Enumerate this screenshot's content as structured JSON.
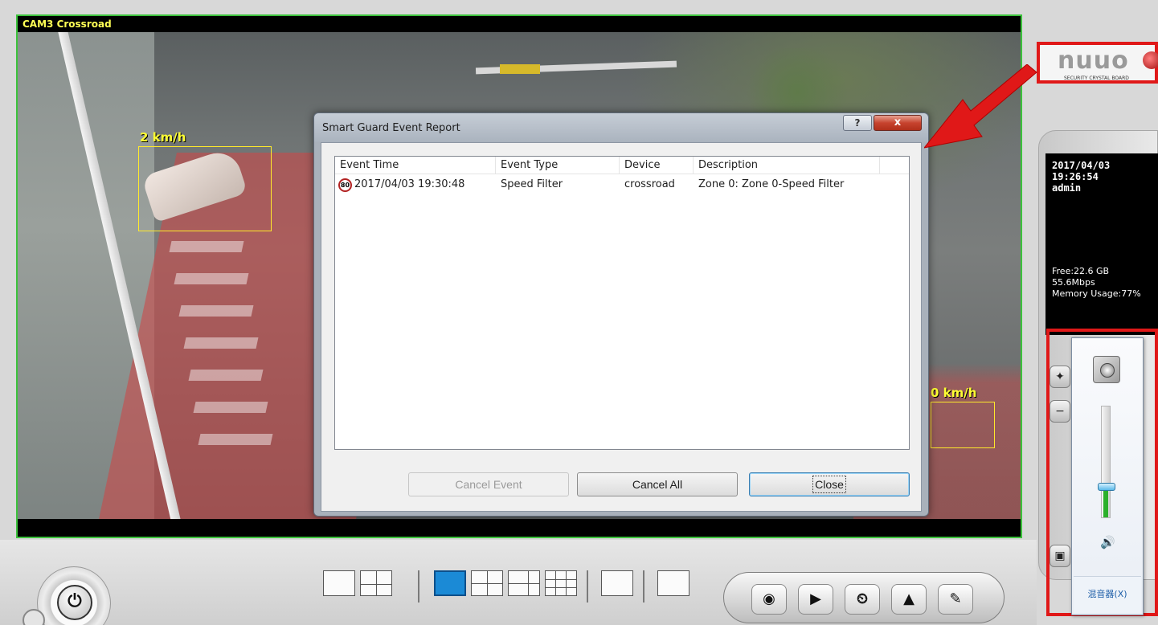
{
  "camera": {
    "title": "CAM3 Crossroad",
    "overlay_speed_left": "2 km/h",
    "overlay_speed_right": "0 km/h"
  },
  "dialog": {
    "title": "Smart Guard Event Report",
    "help_glyph": "?",
    "close_glyph": "x",
    "columns": [
      "Event Time",
      "Event Type",
      "Device",
      "Description"
    ],
    "rows": [
      {
        "icon": "speed-limit-80-icon",
        "icon_text": "80",
        "event_time": "2017/04/03 19:30:48",
        "event_type": "Speed Filter",
        "device": "crossroad",
        "description": "Zone 0: Zone 0-Speed Filter"
      }
    ],
    "buttons": {
      "cancel_event": "Cancel Event",
      "cancel_all": "Cancel All",
      "close": "Close"
    }
  },
  "logo": {
    "text": "nuuo",
    "subtitle": "SECURITY CRYSTAL BOARD"
  },
  "status": {
    "date": "2017/04/03",
    "time": "19:26:54",
    "user": "admin",
    "free": "Free:22.6 GB",
    "rate": "55.6Mbps",
    "memory": "Memory Usage:77%"
  },
  "mixer": {
    "volume": 0.28,
    "footer_label": "混音器(X)"
  },
  "toolbar": {
    "icons": [
      "record-icon",
      "playback-icon",
      "schedule-icon",
      "alert-icon",
      "tools-icon"
    ]
  },
  "colors": {
    "overlay_text": "#ffff33",
    "annotation_red": "#e01818",
    "cam_border": "#3cc23c",
    "active_layout": "#1b8ad6"
  }
}
